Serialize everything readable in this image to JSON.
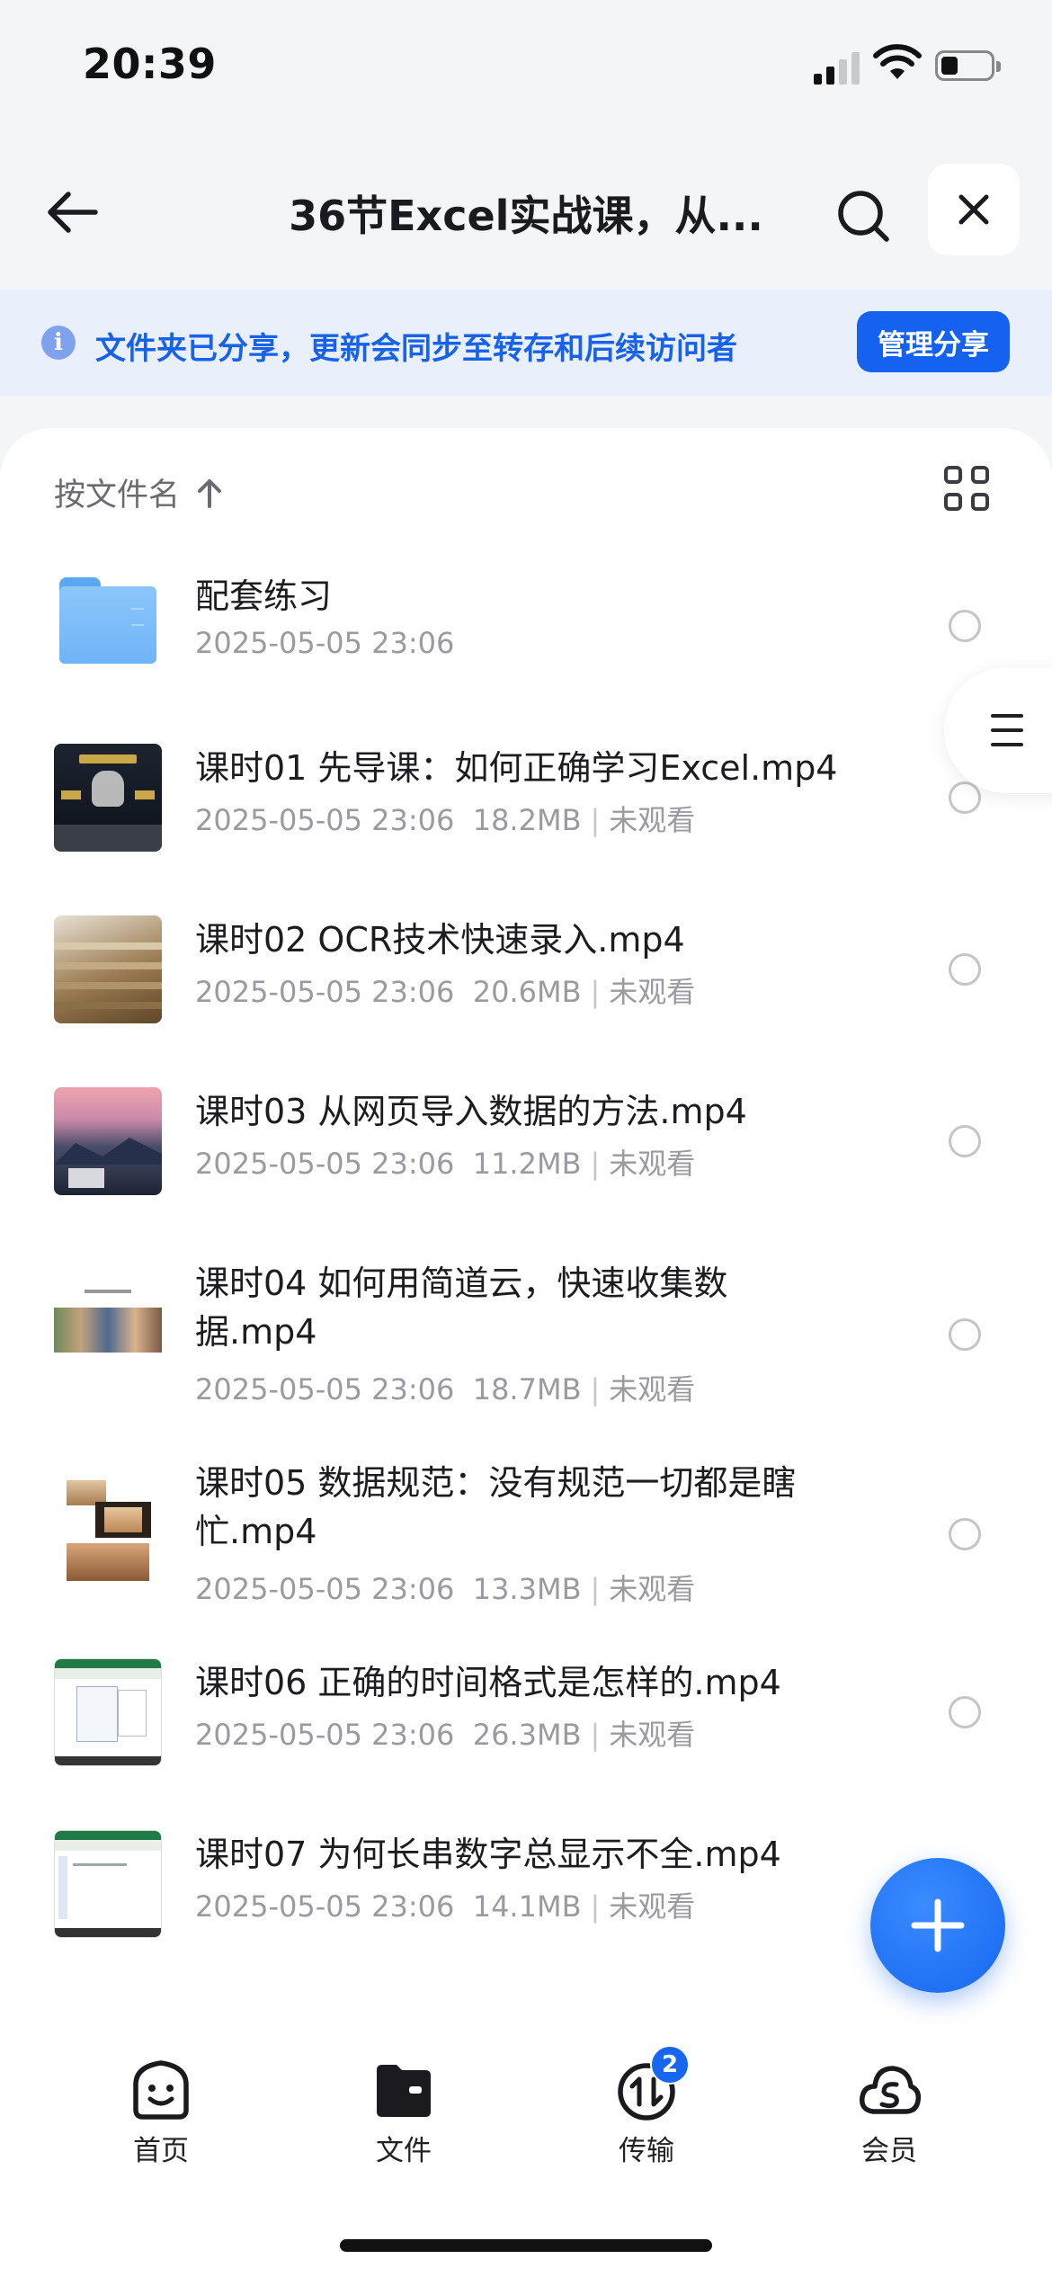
{
  "status_bar": {
    "time": "20:39"
  },
  "header": {
    "title": "36节Excel实战课，从..."
  },
  "banner": {
    "text": "文件夹已分享，更新会同步至转存和后续访问者",
    "button": "管理分享"
  },
  "sort": {
    "label": "按文件名"
  },
  "files": [
    {
      "name": "配套练习",
      "date": "2025-05-05 23:06",
      "size": "",
      "status": "",
      "thumb": "folder"
    },
    {
      "name": "课时01 先导课：如何正确学习Excel.mp4",
      "date": "2025-05-05 23:06",
      "size": "18.2MB",
      "status": "未观看",
      "thumb": "robot"
    },
    {
      "name": "课时02 OCR技术快速录入.mp4",
      "date": "2025-05-05 23:06",
      "size": "20.6MB",
      "status": "未观看",
      "thumb": "papers"
    },
    {
      "name": "课时03 从网页导入数据的方法.mp4",
      "date": "2025-05-05 23:06",
      "size": "11.2MB",
      "status": "未观看",
      "thumb": "landscape"
    },
    {
      "name": "课时04 如何用简道云，快速收集数据.mp4",
      "date": "2025-05-05 23:06",
      "size": "18.7MB",
      "status": "未观看",
      "thumb": "people"
    },
    {
      "name": "课时05 数据规范：没有规范一切都是瞎忙.mp4",
      "date": "2025-05-05 23:06",
      "size": "13.3MB",
      "status": "未观看",
      "thumb": "houses"
    },
    {
      "name": "课时06 正确的时间格式是怎样的.mp4",
      "date": "2025-05-05 23:06",
      "size": "26.3MB",
      "status": "未观看",
      "thumb": "excel"
    },
    {
      "name": "课时07 为何长串数字总显示不全.mp4",
      "date": "2025-05-05 23:06",
      "size": "14.1MB",
      "status": "未观看",
      "thumb": "excel"
    }
  ],
  "tabs": [
    {
      "label": "首页",
      "icon": "smile-face-icon"
    },
    {
      "label": "文件",
      "icon": "folder-icon"
    },
    {
      "label": "传输",
      "icon": "transfer-icon",
      "badge": "2"
    },
    {
      "label": "会员",
      "icon": "cloud-member-icon"
    }
  ],
  "colors": {
    "accent": "#1662f0",
    "banner_bg": "#e9f0fc"
  }
}
